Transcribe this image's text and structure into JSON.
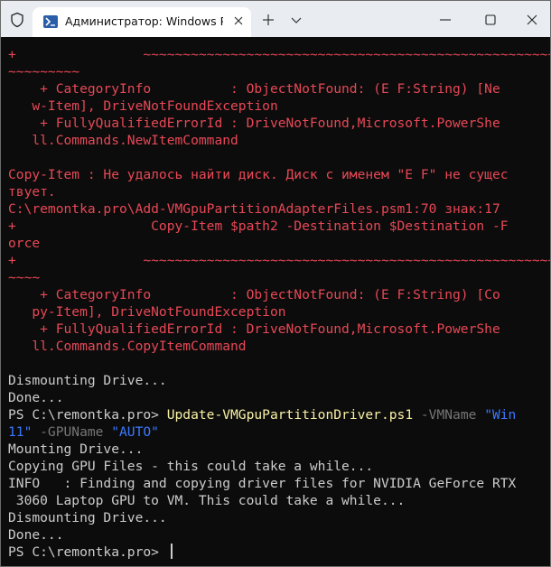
{
  "window": {
    "tab_title": "Администратор: Windows Pc",
    "icons": {
      "shield": "shield-icon",
      "powershell": "powershell-icon",
      "tab_close": "close-icon",
      "new_tab": "plus-icon",
      "dropdown": "chevron-down-icon",
      "minimize": "minimize-icon",
      "maximize": "maximize-icon",
      "close": "close-icon"
    }
  },
  "colors": {
    "terminal_bg": "#0c0c0c",
    "default_text": "#cccccc",
    "error_text": "#e74856",
    "command": "#f9f1a5",
    "parameter": "#767676",
    "string": "#3b78ff"
  },
  "terminal": {
    "lines": [
      "+                ~~~~~~~~~~~~~~~~~~~~~~~~~~~~~~~~~~~~~~~~~~~~~~~~~~~~",
      "~~~~~~~~~",
      "    + CategoryInfo          : ObjectNotFound: (E F:String) [Ne",
      "   w-Item], DriveNotFoundException",
      "    + FullyQualifiedErrorId : DriveNotFound,Microsoft.PowerShe",
      "   ll.Commands.NewItemCommand",
      "",
      "Copy-Item : Не удалось найти диск. Диск с именем \"E F\" не сущес",
      "твует.",
      "C:\\remontka.pro\\Add-VMGpuPartitionAdapterFiles.psm1:70 знак:17",
      "+                 Copy-Item $path2 -Destination $Destination -F",
      "orce",
      "+                ~~~~~~~~~~~~~~~~~~~~~~~~~~~~~~~~~~~~~~~~~~~~~~~~~~~~",
      "~~~~",
      "    + CategoryInfo          : ObjectNotFound: (E F:String) [Co",
      "   py-Item], DriveNotFoundException",
      "    + FullyQualifiedErrorId : DriveNotFound,Microsoft.PowerShe",
      "   ll.Commands.CopyItemCommand",
      "",
      "Dismounting Drive...",
      "Done...",
      "",
      "",
      "Mounting Drive...",
      "Copying GPU Files - this could take a while...",
      "INFO   : Finding and copying driver files for NVIDIA GeForce RTX",
      " 3060 Laptop GPU to VM. This could take a while...",
      "Dismounting Drive...",
      "Done...",
      "PS C:\\remontka.pro> "
    ],
    "command_line": {
      "prompt": "PS C:\\remontka.pro> ",
      "command": "Update-VMGpuPartitionDriver.ps1",
      "param1": " -VMName ",
      "value1": "\"Win",
      "value1_cont": "11\"",
      "param2": " -GPUName ",
      "value2": "\"AUTO\""
    }
  }
}
